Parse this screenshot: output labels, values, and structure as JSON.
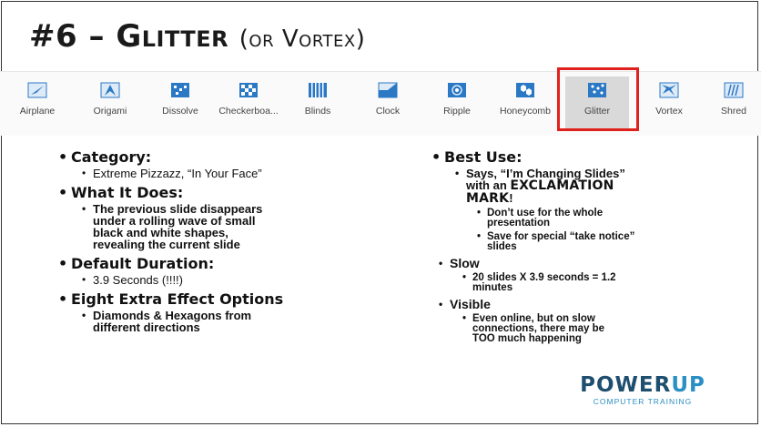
{
  "slide": {
    "title_prefix": "#6 – ",
    "title_main": "Glitter",
    "title_alt": "(or Vortex)"
  },
  "ribbon": {
    "items": [
      {
        "label": "Airplane",
        "icon": "airplane-icon"
      },
      {
        "label": "Origami",
        "icon": "origami-icon"
      },
      {
        "label": "Dissolve",
        "icon": "dissolve-icon"
      },
      {
        "label": "Checkerboa...",
        "icon": "checkerboard-icon"
      },
      {
        "label": "Blinds",
        "icon": "blinds-icon"
      },
      {
        "label": "Clock",
        "icon": "clock-icon"
      },
      {
        "label": "Ripple",
        "icon": "ripple-icon"
      },
      {
        "label": "Honeycomb",
        "icon": "honeycomb-icon"
      },
      {
        "label": "Glitter",
        "icon": "glitter-icon",
        "selected": true
      },
      {
        "label": "Vortex",
        "icon": "vortex-icon"
      },
      {
        "label": "Shred",
        "icon": "shred-icon"
      }
    ],
    "selection_color": "#e0201c"
  },
  "left": {
    "category_head": "Category:",
    "category_val": "Extreme Pizzazz, “In Your Face”",
    "does_head": "What It Does:",
    "does_val_1": "The previous slide disappears",
    "does_val_2": "under a rolling wave of small",
    "does_val_3": "black and white shapes,",
    "does_val_4": "revealing the current slide",
    "duration_head": "Default Duration:",
    "duration_val": "3.9 Seconds (!!!!)",
    "options_head": "Eight Extra Effect Options",
    "options_val_1": "Diamonds & Hexagons from",
    "options_val_2": "different directions"
  },
  "right": {
    "use_head": "Best Use:",
    "use_says_1": "Says, “I’m Changing Slides”",
    "use_says_2": "with an",
    "use_says_emph_1": "EXCLAMATION",
    "use_says_emph_2": "MARK",
    "use_says_bang": "!",
    "use_sub_1a": "Don’t use for the whole",
    "use_sub_1b": "presentation",
    "use_sub_2a": "Save for special “take notice”",
    "use_sub_2b": "slides",
    "slow_head": "Slow",
    "slow_val_1": "20 slides X 3.9 seconds = 1.2",
    "slow_val_2": "minutes",
    "visible_head": "Visible",
    "visible_val_1": "Even online, but on slow",
    "visible_val_2": "connections, there may be",
    "visible_val_3": "TOO much happening"
  },
  "logo": {
    "word_power": "POWER",
    "word_up": "UP",
    "tagline": "COMPUTER TRAINING"
  },
  "colors": {
    "ribbon_icon_blue": "#2b78c5",
    "logo_dark": "#1f4f6f",
    "logo_light": "#2a8fc4"
  }
}
